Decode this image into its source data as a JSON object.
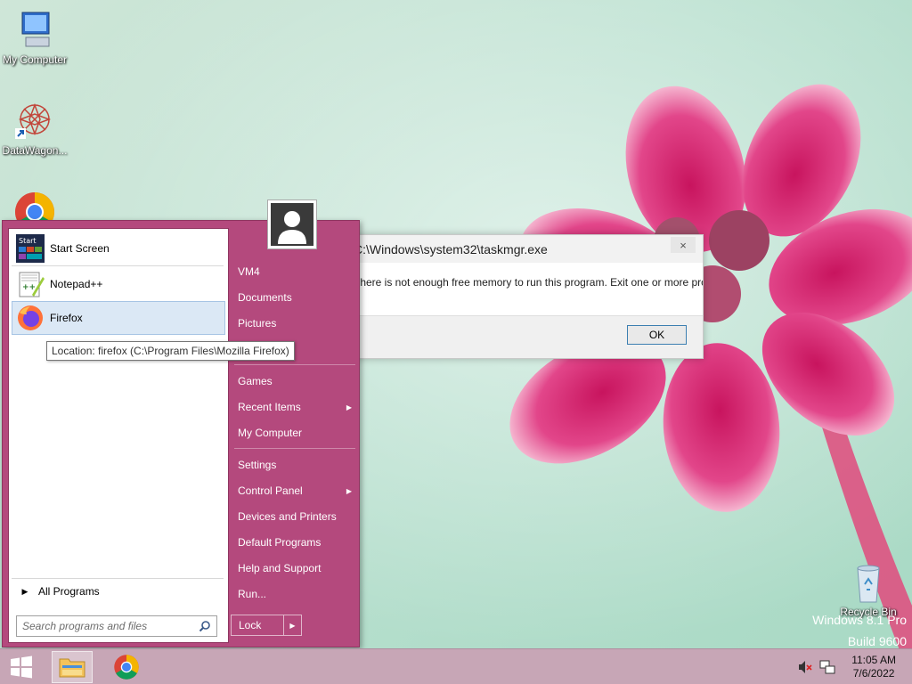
{
  "desktop": {
    "icons": [
      {
        "label": "My Computer",
        "icon": "computer-icon"
      },
      {
        "label": "DataWagon...",
        "icon": "datawagon-icon"
      },
      {
        "label": "",
        "icon": "chrome-icon"
      },
      {
        "label": "Recycle Bin",
        "icon": "recycle-bin-icon"
      }
    ],
    "watermark": [
      "Windows 8.1 Pro",
      "Build 9600"
    ]
  },
  "start_menu": {
    "programs": [
      {
        "label": "Start Screen",
        "icon": "start-screen-icon"
      },
      {
        "label": "Notepad++",
        "icon": "notepadpp-icon"
      },
      {
        "label": "Firefox",
        "icon": "firefox-icon"
      }
    ],
    "all_programs_label": "All Programs",
    "search_placeholder": "Search programs and files",
    "tooltip": "Location: firefox (C:\\Program Files\\Mozilla Firefox)",
    "right_items": [
      {
        "label": "VM4"
      },
      {
        "label": "Documents"
      },
      {
        "label": "Pictures"
      },
      {
        "label": "Games"
      },
      {
        "label": "Recent Items",
        "submenu": true
      },
      {
        "label": "My Computer"
      },
      {
        "label": "Settings"
      },
      {
        "label": "Control Panel",
        "submenu": true
      },
      {
        "label": "Devices and Printers"
      },
      {
        "label": "Default Programs"
      },
      {
        "label": "Help and Support"
      },
      {
        "label": "Run..."
      }
    ],
    "lock_label": "Lock"
  },
  "dialog": {
    "title": "C:\\Windows\\system32\\taskmgr.exe",
    "message": "There is not enough free memory to run this program. Exit one or more programs, and then",
    "ok_label": "OK",
    "close_glyph": "×"
  },
  "taskbar": {
    "time": "11:05 AM",
    "date": "7/6/2022"
  },
  "colors": {
    "start_menu_bg": "#b4497d",
    "taskbar_bg": "#c7a6b6",
    "selection": "#dbe8f5"
  }
}
